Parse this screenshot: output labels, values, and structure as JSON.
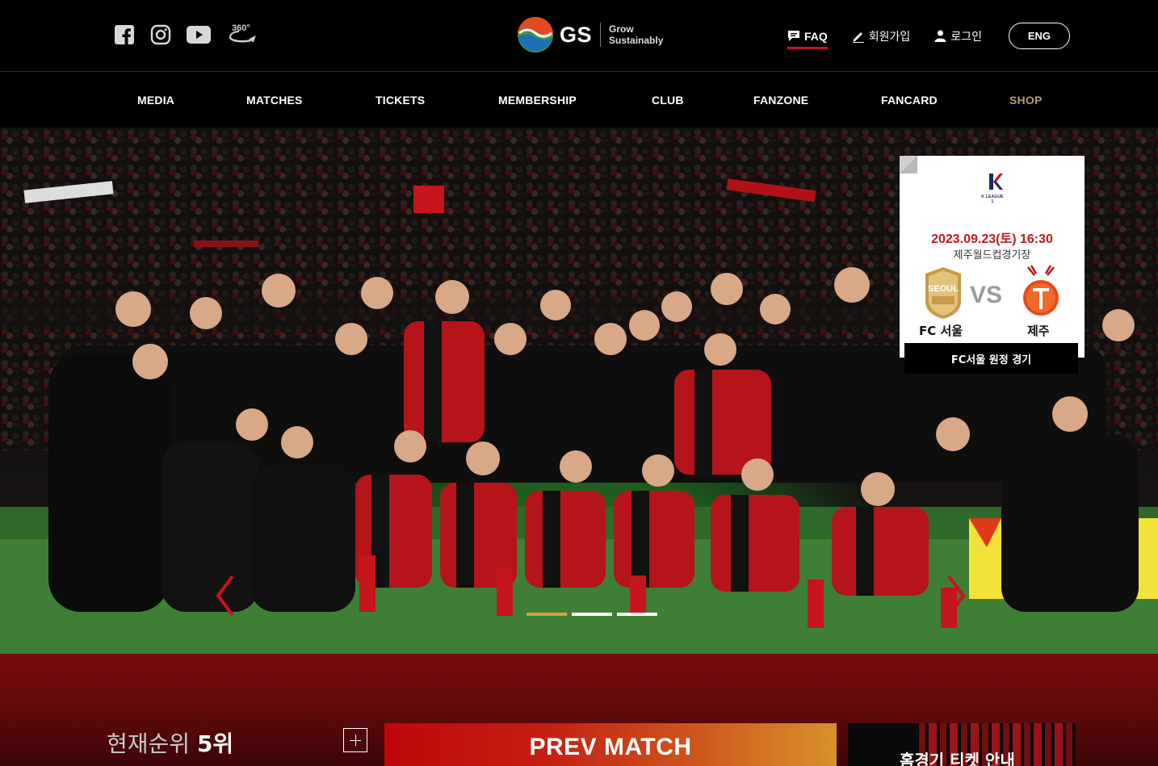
{
  "header": {
    "social": [
      "facebook-icon",
      "instagram-icon",
      "youtube-icon",
      "vr-360-icon"
    ],
    "vr_label": "360°",
    "sponsor": {
      "name": "GS",
      "tagline_1": "Grow",
      "tagline_2": "Sustainably"
    },
    "util": {
      "faq": "FAQ",
      "signup": "회원가입",
      "login": "로그인",
      "lang": "ENG"
    }
  },
  "nav": {
    "items": [
      "MEDIA",
      "MATCHES",
      "TICKETS",
      "MEMBERSHIP",
      "CLUB",
      "FANZONE",
      "FANCARD",
      "SHOP"
    ],
    "active": "SHOP"
  },
  "hero": {
    "slides": 3,
    "active_slide": 1,
    "colors": {
      "accent": "#c4161c",
      "gold": "#d9a23a",
      "shop": "#b69a6a"
    }
  },
  "match_card": {
    "league": "K LEAGUE 1",
    "datetime": "2023.09.23(토) 16:30",
    "venue": "제주월드컵경기장",
    "home": "FC 서울",
    "home_emblem_text": "SEOUL",
    "vs": "VS",
    "away": "제주",
    "button": "FC서울 원정 경기"
  },
  "lower": {
    "rank_label": "현재순위",
    "rank_value": "5위",
    "prev_match": "PREV MATCH",
    "ticket_info": "홈경기 티켓 안내"
  }
}
